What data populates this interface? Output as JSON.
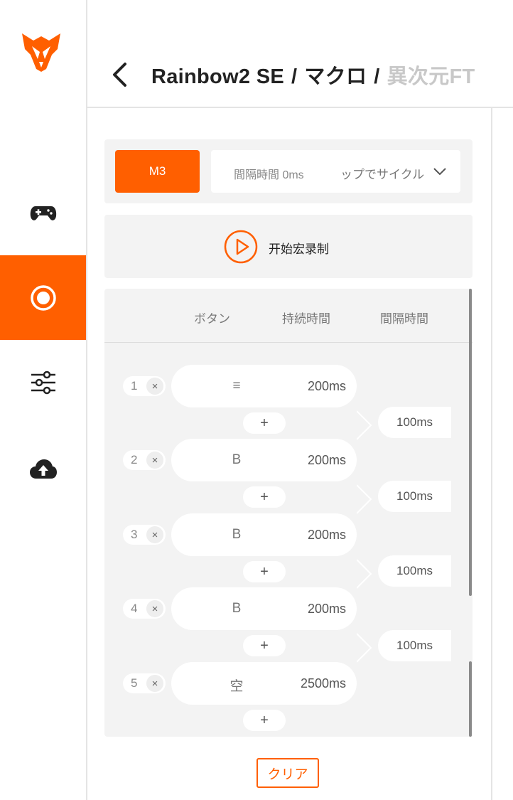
{
  "brand": {
    "accent": "#ff5f00"
  },
  "sidebar": {
    "items": [
      {
        "icon": "gamepad-icon",
        "active": false
      },
      {
        "icon": "macro-record-icon",
        "active": true
      },
      {
        "icon": "sliders-icon",
        "active": false
      },
      {
        "icon": "cloud-upload-icon",
        "active": false
      }
    ]
  },
  "header": {
    "crumbs": [
      "Rainbow2 SE",
      "マクロ",
      "異次元FT"
    ],
    "separator": "/"
  },
  "macro": {
    "key": "M3",
    "interval_label": "間隔時間 0ms",
    "cycle_label": "ップでサイクル",
    "record_label": "开始宏录制"
  },
  "table": {
    "headers": [
      "ボタン",
      "持続時間",
      "間隔時間"
    ],
    "rows": [
      {
        "no": "1",
        "key": "≡",
        "duration": "200ms",
        "interval": "100ms"
      },
      {
        "no": "2",
        "key": "B",
        "duration": "200ms",
        "interval": "100ms"
      },
      {
        "no": "3",
        "key": "B",
        "duration": "200ms",
        "interval": "100ms"
      },
      {
        "no": "4",
        "key": "B",
        "duration": "200ms",
        "interval": "100ms"
      },
      {
        "no": "5",
        "key": "空",
        "duration": "2500ms",
        "interval": ""
      }
    ],
    "remove_glyph": "×",
    "add_glyph": "+"
  },
  "clear_label": "クリア"
}
